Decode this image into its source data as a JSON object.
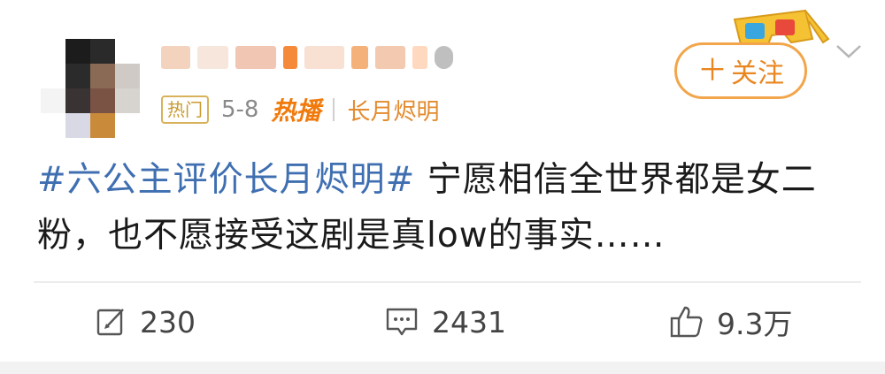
{
  "post": {
    "author": {
      "avatar": "avatar-blurred",
      "name": ""
    },
    "badge_hot": "热门",
    "date": "5-8",
    "hot_broadcast_label": "热播",
    "topic": "长月烬明",
    "follow_label": "关注",
    "follow_icon": "plus-icon",
    "text_hashtag": "#六公主评价长月烬明#",
    "text_line1_rest": " 宁愿相信全世界都是女二",
    "text_line2": "粉，也不愿接受这剧是真low的事实……"
  },
  "actions": {
    "repost_count": "230",
    "comment_count": "2431",
    "like_count": "9.3万"
  },
  "colors": {
    "hashtag": "#3f6fb1",
    "accent_orange": "#f07a0c",
    "follow_border": "#f2a54a"
  }
}
